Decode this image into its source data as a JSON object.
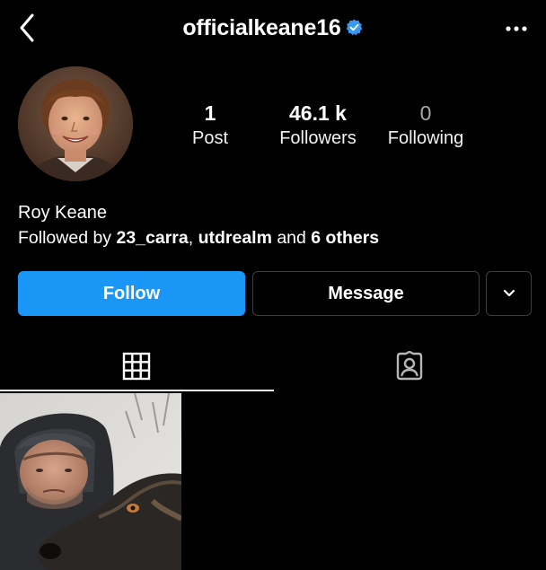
{
  "header": {
    "back_icon": "chevron-left-icon",
    "username": "officialkeane16",
    "verified_icon": "verified-badge-icon",
    "more_icon": "more-horizontal-icon"
  },
  "profile": {
    "avatar_alt": "profile picture",
    "display_name": "Roy Keane",
    "followed_by_prefix": "Followed by ",
    "followed_by_user1": "23_carra",
    "followed_by_sep": ", ",
    "followed_by_user2": "utdrealm",
    "followed_by_and": " and ",
    "followed_by_others": "6 others"
  },
  "stats": {
    "posts": {
      "count": "1",
      "label": "Post"
    },
    "followers": {
      "count": "46.1 k",
      "label": "Followers"
    },
    "following": {
      "count": "0",
      "label": "Following"
    }
  },
  "actions": {
    "follow_label": "Follow",
    "message_label": "Message",
    "dropdown_icon": "chevron-down-icon"
  },
  "tabs": [
    {
      "icon": "grid-icon",
      "active": true
    },
    {
      "icon": "tagged-person-icon",
      "active": false
    }
  ],
  "colors": {
    "background": "#000000",
    "accent": "#1a96f6",
    "verified": "#3897f0",
    "muted": "#a8a8a8"
  },
  "posts": [
    {
      "kind": "photo"
    }
  ]
}
